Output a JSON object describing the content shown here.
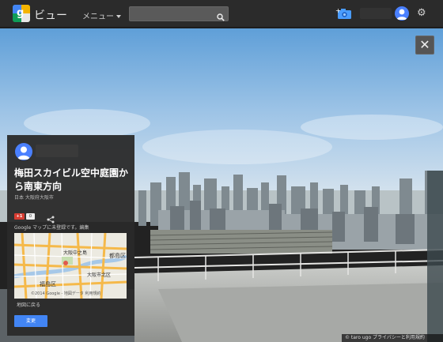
{
  "header": {
    "app_title": "ビュー",
    "menu_label": "メニュー",
    "search_placeholder": ""
  },
  "card": {
    "title": "梅田スカイビル空中庭園から南東方向",
    "subtitle": "日本 大阪府大阪市",
    "plus_label": "+1",
    "plus_count": "0",
    "note": "Google マップに未登録です。編集",
    "map_labels": [
      "大阪中之島",
      "都島区",
      "福島区",
      "大阪市北区"
    ],
    "map_copyright": "©2014 Google - 地図データ 利用規約",
    "map_back": "地図に戻る",
    "edit_button": "変更"
  },
  "footer": {
    "text": "© taro ugo   プライバシーと利用規約"
  },
  "colors": {
    "topbar": "#2b2b2b",
    "accent_blue": "#4285f4",
    "gplus_red": "#d73d32"
  },
  "icons": {
    "search": "search-icon",
    "camera": "add-photo-camera-icon",
    "gear": "gear-icon",
    "close": "close-icon",
    "share": "share-icon"
  }
}
